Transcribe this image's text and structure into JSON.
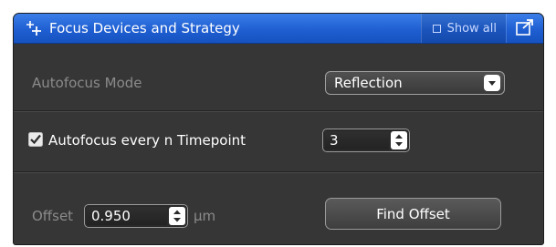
{
  "header": {
    "title": "Focus Devices and Strategy",
    "show_all_label": "Show all",
    "icons": [
      "plus-sparkle-icon",
      "checkbox-icon",
      "undock-icon"
    ]
  },
  "autofocus_mode": {
    "label": "Autofocus Mode",
    "value": "Reflection"
  },
  "timepoint": {
    "checked": true,
    "label": "Autofocus every n Timepoint",
    "value": "3"
  },
  "offset": {
    "label": "Offset",
    "value": "0.950",
    "unit": "µm",
    "find_button": "Find Offset"
  },
  "colors": {
    "header_blue": "#1f5fd2",
    "panel_bg": "#363636",
    "disabled_text": "#8b8b8b"
  }
}
